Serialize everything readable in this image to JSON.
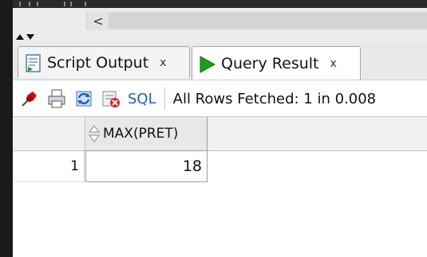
{
  "tabs": [
    {
      "label": "Script Output",
      "close": "x",
      "icon": "script-output-icon",
      "active": false
    },
    {
      "label": "Query Result",
      "close": "x",
      "icon": "run-triangle-icon",
      "active": true
    }
  ],
  "toolbar": {
    "icons": [
      "pin-icon",
      "print-icon",
      "refresh-icon",
      "clear-icon"
    ],
    "sql_label": "SQL",
    "status": "All Rows Fetched: 1 in 0.008"
  },
  "grid": {
    "columns": [
      {
        "name": "MAX(PRET)"
      }
    ],
    "rows": [
      {
        "rownum": "1",
        "values": [
          "18"
        ]
      }
    ]
  },
  "scroll": {
    "left_arrow": "<"
  },
  "colors": {
    "accent_sql": "#1f5fb6",
    "run_green": "#1a9e1a"
  }
}
